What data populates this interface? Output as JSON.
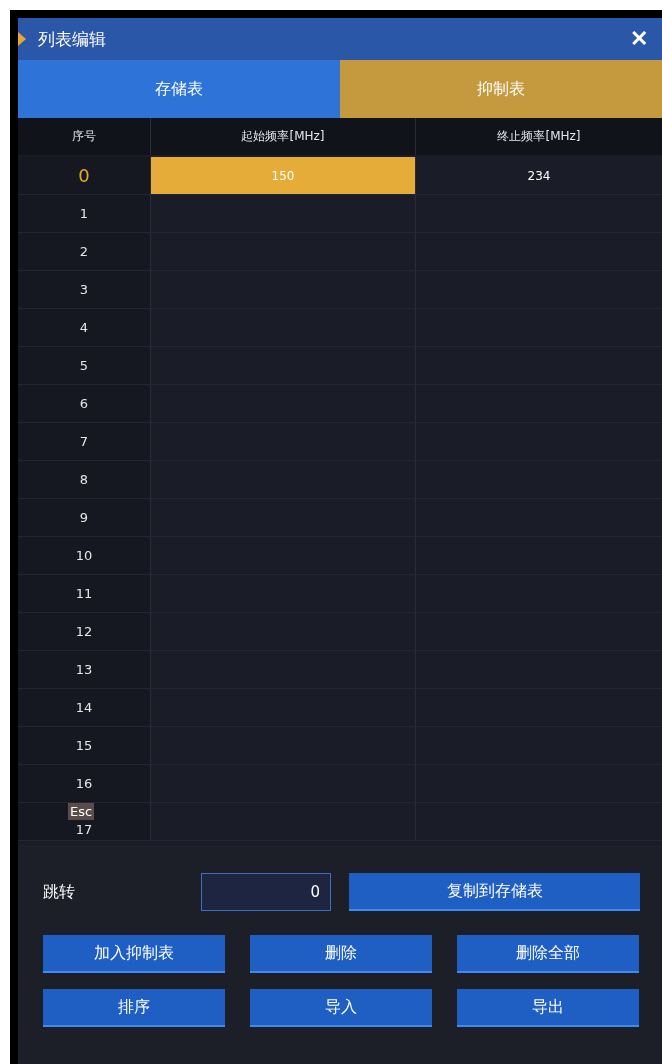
{
  "window": {
    "title": "列表编辑",
    "close": "✕"
  },
  "tabs": [
    {
      "label": "存储表",
      "selected": false
    },
    {
      "label": "抑制表",
      "selected": true
    }
  ],
  "table": {
    "columns": [
      "序号",
      "起始频率[MHz]",
      "终止频率[MHz]"
    ],
    "rows": [
      {
        "index": "0",
        "selected": true,
        "cells": [
          {
            "text": "150",
            "selected": true
          },
          {
            "text": "234",
            "selected": false
          }
        ]
      },
      {
        "index": "1",
        "selected": false
      },
      {
        "index": "2",
        "selected": false
      },
      {
        "index": "3",
        "selected": false
      },
      {
        "index": "4",
        "selected": false
      },
      {
        "index": "5",
        "selected": false
      },
      {
        "index": "6",
        "selected": false
      },
      {
        "index": "7",
        "selected": false
      },
      {
        "index": "8",
        "selected": false
      },
      {
        "index": "9",
        "selected": false
      },
      {
        "index": "10",
        "selected": false
      },
      {
        "index": "11",
        "selected": false
      },
      {
        "index": "12",
        "selected": false
      },
      {
        "index": "13",
        "selected": false
      },
      {
        "index": "14",
        "selected": false
      },
      {
        "index": "15",
        "selected": false
      },
      {
        "index": "16",
        "selected": false
      },
      {
        "index": "17",
        "selected": false
      }
    ]
  },
  "esc_badge": "Esc",
  "jump": {
    "label": "跳转",
    "value": "0"
  },
  "buttons": [
    "复制到存储表",
    "加入抑制表",
    "删除",
    "删除全部",
    "排序",
    "导入",
    "导出"
  ]
}
